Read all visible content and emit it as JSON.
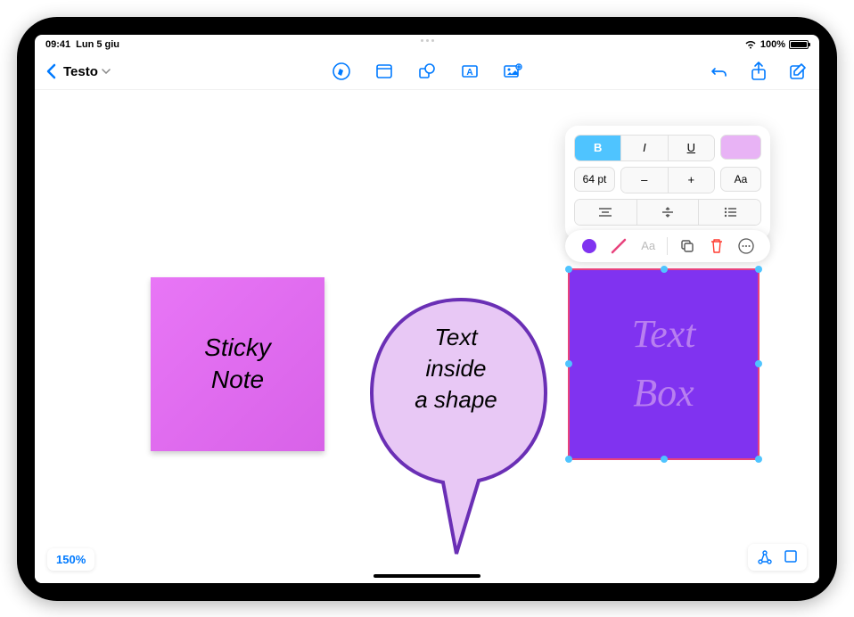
{
  "status": {
    "time": "09:41",
    "date": "Lun 5 giu",
    "battery": "100%"
  },
  "toolbar": {
    "title": "Testo"
  },
  "format": {
    "bold": "B",
    "italic": "I",
    "underline": "U",
    "size": "64 pt",
    "minus": "–",
    "plus": "+",
    "caps": "Aa"
  },
  "context": {
    "text_style": "Aa"
  },
  "canvas": {
    "sticky": "Sticky\nNote",
    "speech": "Text\ninside\na shape",
    "textbox": "Text\nBox",
    "zoom": "150%"
  }
}
